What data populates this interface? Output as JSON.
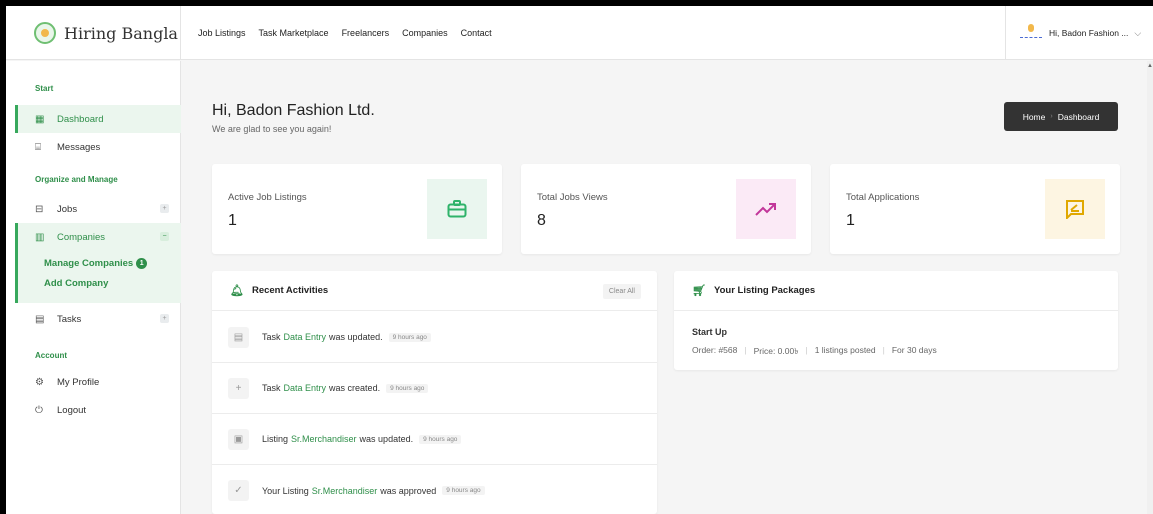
{
  "brand": {
    "name": "Hiring Bangla",
    "logo_icon": "hiring-bangla-logo"
  },
  "nav": [
    "Job Listings",
    "Task Marketplace",
    "Freelancers",
    "Companies",
    "Contact"
  ],
  "user": {
    "label": "Hi, Badon Fashion ...",
    "icon": "chevron-down-icon"
  },
  "sidebar": {
    "sections": {
      "start": "Start",
      "organize": "Organize and Manage",
      "account": "Account"
    },
    "items": {
      "dashboard": "Dashboard",
      "messages": "Messages",
      "jobs": "Jobs",
      "companies": "Companies",
      "tasks": "Tasks",
      "profile": "My Profile",
      "logout": "Logout"
    },
    "submenu": {
      "manage": "Manage Companies",
      "manage_badge": "1",
      "add": "Add Company"
    }
  },
  "main": {
    "greeting": "Hi, Badon Fashion Ltd.",
    "subtitle": "We are glad to see you again!",
    "breadcrumb": {
      "home": "Home",
      "current": "Dashboard"
    }
  },
  "stats": [
    {
      "label": "Active Job Listings",
      "value": "1",
      "icon": "briefcase-icon",
      "color": "#2fb36a",
      "bg": "#eaf6ef"
    },
    {
      "label": "Total Jobs Views",
      "value": "8",
      "icon": "trend-up-icon",
      "color": "#c2379a",
      "bg": "#fbeaf6"
    },
    {
      "label": "Total Applications",
      "value": "1",
      "icon": "message-icon",
      "color": "#e0a800",
      "bg": "#fdf5e2"
    }
  ],
  "activities": {
    "title": "Recent Activities",
    "clear_label": "Clear All",
    "items": [
      {
        "pre": "Task",
        "link": "Data Entry",
        "post": "was updated.",
        "time": "9 hours ago",
        "icon": "document-icon"
      },
      {
        "pre": "Task",
        "link": "Data Entry",
        "post": "was created.",
        "time": "9 hours ago",
        "icon": "plus-icon"
      },
      {
        "pre": "Listing",
        "link": "Sr.Merchandiser",
        "post": "was updated.",
        "time": "9 hours ago",
        "icon": "save-icon"
      },
      {
        "pre": "Your Listing",
        "link": "Sr.Merchandiser",
        "post": "was approved",
        "time": "9 hours ago",
        "icon": "check-circle-icon"
      }
    ]
  },
  "packages": {
    "title": "Your Listing Packages",
    "name": "Start Up",
    "order": "Order: #568",
    "price": "Price: 0.00৳",
    "posted": "1 listings posted",
    "duration": "For 30 days"
  }
}
